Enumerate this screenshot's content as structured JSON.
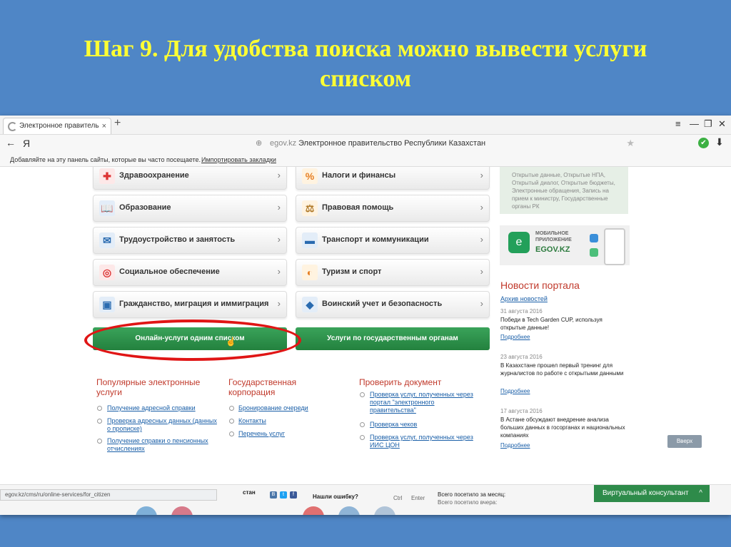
{
  "slide": {
    "title_line1": "Шаг 9. Для удобства поиска можно вывести услуги",
    "title_line2": "списком"
  },
  "browser": {
    "tab_title": "Электронное правитель",
    "tab_close": "×",
    "new_tab": "+",
    "window_controls": [
      "≡",
      "—",
      "❐",
      "✕"
    ],
    "nav_back": "←",
    "nav_yandex": "Я",
    "address_host": "egov.kz",
    "address_title": "Электронное правительство Республики Казахстан",
    "bookmarks_text": "Добавляйте на эту панель сайты, которые вы часто посещаете.",
    "bookmarks_import": "Импортировать закладки"
  },
  "categories": {
    "left": [
      {
        "label": "Здравоохранение",
        "icon": "health-icon"
      },
      {
        "label": "Образование",
        "icon": "book-icon"
      },
      {
        "label": "Трудоустройство и занятость",
        "icon": "employment-icon"
      },
      {
        "label": "Социальное обеспечение",
        "icon": "lifebuoy-icon"
      },
      {
        "label": "Гражданство, миграция и иммиграция",
        "icon": "passport-icon"
      }
    ],
    "right": [
      {
        "label": "Налоги и финансы",
        "icon": "percent-icon"
      },
      {
        "label": "Правовая помощь",
        "icon": "scales-icon"
      },
      {
        "label": "Транспорт и коммуникации",
        "icon": "truck-icon"
      },
      {
        "label": "Туризм и спорт",
        "icon": "goggles-icon"
      },
      {
        "label": "Воинский учет и безопасность",
        "icon": "shield-icon"
      }
    ],
    "arrow": "›"
  },
  "buttons": {
    "online_list": "Онлайн-услуги одним списком",
    "by_agency": "Услуги по государственным органам"
  },
  "popular": {
    "heading": "Популярные электронные услуги",
    "links": [
      "Получение адресной справки",
      "Проверка адресных данных (данных о прописке)",
      "Получение справки о пенсионных отчислениях"
    ]
  },
  "corp": {
    "heading": "Государственная корпорация",
    "links": [
      "Бронирование очереди",
      "Контакты",
      "Перечень услуг"
    ]
  },
  "check": {
    "heading": "Проверить документ",
    "links": [
      "Проверка услуг, полученных через портал \"электронного правительства\"",
      "Проверка чеков",
      "Проверка услуг, полученных через ИИС ЦОН"
    ]
  },
  "sidebar": {
    "box_text": "Открытые данные, Открытые НПА, Открытый диалог, Открытые бюджеты, Электронные обращения, Запись на прием к министру, Государственные органы РК",
    "app_mobile": "МОБИЛЬНОЕ ПРИЛОЖЕНИЕ",
    "app_name": "EGOV.KZ",
    "news_heading": "Новости портала",
    "news_archive": "Архив новостей",
    "news": [
      {
        "date": "31 августа 2016",
        "text": "Победи в Tech Garden CUP, используя открытые данные!",
        "more": "Подробнее"
      },
      {
        "date": "23 августа 2016",
        "text": "В Казахстане прошел первый тренинг для журналистов по работе с открытыми данными",
        "more": "Подробнее"
      },
      {
        "date": "17 августа 2016",
        "text": "В Астане обсуждают внедрение анализа больших данных в госорганах и национальных компаниях",
        "more": "Подробнее"
      }
    ],
    "up_button": "Вверх"
  },
  "footer": {
    "status_url": "egov.kz/cms/ru/online-services/for_citizen",
    "stan": "стан",
    "found_error": "Нашли ошибку?",
    "ctrl": "Ctrl",
    "enter": "Enter",
    "visits": "Всего посетило за месяц:",
    "visits2": "Всего посетило вчера:",
    "consultant": "Виртуальный консультант",
    "consultant_icon": "^"
  },
  "colors": {
    "title": "#ffff33",
    "background": "#4f86c6",
    "accent_green": "#2e8b4a",
    "highlight_red": "#e01515",
    "heading_red": "#c0392b",
    "link_blue": "#1a5fa8"
  }
}
